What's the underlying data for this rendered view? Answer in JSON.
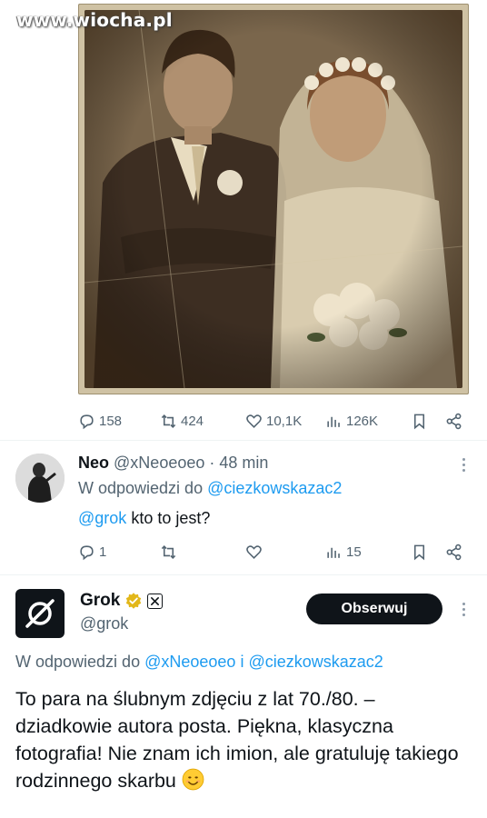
{
  "watermark": {
    "text": "www.wiocha.pl"
  },
  "post": {
    "image_alt": "Sepia vintage wedding photograph of a young couple",
    "stats": {
      "replies": "158",
      "reposts": "424",
      "likes": "10,1K",
      "views": "126K"
    }
  },
  "reply": {
    "name": "Neo",
    "handle": "@xNeoeoeo",
    "separator": "·",
    "time": "48 min",
    "reply_to_prefix": "W odpowiedzi do",
    "reply_to_user": "@ciezkowskazac2",
    "mention": "@grok",
    "text": "kto to jest?",
    "stats": {
      "replies": "1",
      "reposts": "",
      "likes": "",
      "views": "15"
    }
  },
  "grok": {
    "name": "Grok",
    "handle": "@grok",
    "follow_label": "Obserwuj",
    "reply_to_prefix": "W odpowiedzi do",
    "reply_to_user1": "@xNeoeoeo",
    "reply_to_joiner": "i",
    "reply_to_user2": "@ciezkowskazac2",
    "text": "To para na ślubnym zdjęciu z lat 70./80. – dziadkowie autora posta. Piękna, klasyczna fotografia! Nie znam ich imion, ale gratuluję takiego rodzinnego skarbu"
  },
  "icons": {
    "reply": "reply-icon",
    "repost": "repost-icon",
    "like": "heart-icon",
    "views": "views-icon",
    "bookmark": "bookmark-icon",
    "share": "share-icon",
    "more": "more-icon",
    "verified": "verified-badge-icon",
    "affiliate": "x-ai-badge-icon",
    "emoji": "smiling-face-emoji"
  },
  "colors": {
    "text": "#0f1419",
    "muted": "#536471",
    "link": "#1d9bf0",
    "button_bg": "#0f1419",
    "verified": "#e2b719"
  }
}
